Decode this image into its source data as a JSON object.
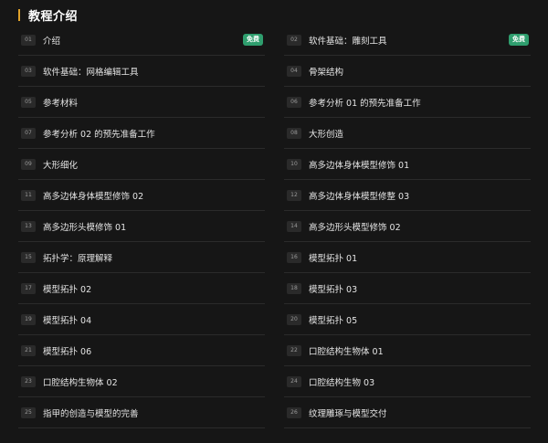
{
  "section": {
    "title": "教程介绍"
  },
  "accent_color": "#e0a22a",
  "badge_color": "#2f9e6e",
  "lessons": [
    {
      "num": "01",
      "title": "介绍",
      "badge": "免费"
    },
    {
      "num": "02",
      "title": "软件基础：雕刻工具",
      "badge": "免费"
    },
    {
      "num": "03",
      "title": "软件基础：网格编辑工具",
      "badge": ""
    },
    {
      "num": "04",
      "title": "骨架结构",
      "badge": ""
    },
    {
      "num": "05",
      "title": "参考材料",
      "badge": ""
    },
    {
      "num": "06",
      "title": "参考分析 01 的预先准备工作",
      "badge": ""
    },
    {
      "num": "07",
      "title": "参考分析 02 的预先准备工作",
      "badge": ""
    },
    {
      "num": "08",
      "title": "大形创造",
      "badge": ""
    },
    {
      "num": "09",
      "title": "大形细化",
      "badge": ""
    },
    {
      "num": "10",
      "title": "高多边体身体模型修饰 01",
      "badge": ""
    },
    {
      "num": "11",
      "title": "高多边体身体模型修饰 02",
      "badge": ""
    },
    {
      "num": "12",
      "title": "高多边体身体模型修整 03",
      "badge": ""
    },
    {
      "num": "13",
      "title": "高多边形头模修饰 01",
      "badge": ""
    },
    {
      "num": "14",
      "title": "高多边形头模型修饰 02",
      "badge": ""
    },
    {
      "num": "15",
      "title": "拓扑学：原理解释",
      "badge": ""
    },
    {
      "num": "16",
      "title": "模型拓扑 01",
      "badge": ""
    },
    {
      "num": "17",
      "title": "模型拓扑 02",
      "badge": ""
    },
    {
      "num": "18",
      "title": "模型拓扑 03",
      "badge": ""
    },
    {
      "num": "19",
      "title": "模型拓扑 04",
      "badge": ""
    },
    {
      "num": "20",
      "title": "模型拓扑 05",
      "badge": ""
    },
    {
      "num": "21",
      "title": "模型拓扑 06",
      "badge": ""
    },
    {
      "num": "22",
      "title": "口腔结构生物体 01",
      "badge": ""
    },
    {
      "num": "23",
      "title": "口腔结构生物体 02",
      "badge": ""
    },
    {
      "num": "24",
      "title": "口腔结构生物 03",
      "badge": ""
    },
    {
      "num": "25",
      "title": "指甲的创造与模型的完善",
      "badge": ""
    },
    {
      "num": "26",
      "title": "纹理雕琢与模型交付",
      "badge": ""
    }
  ]
}
